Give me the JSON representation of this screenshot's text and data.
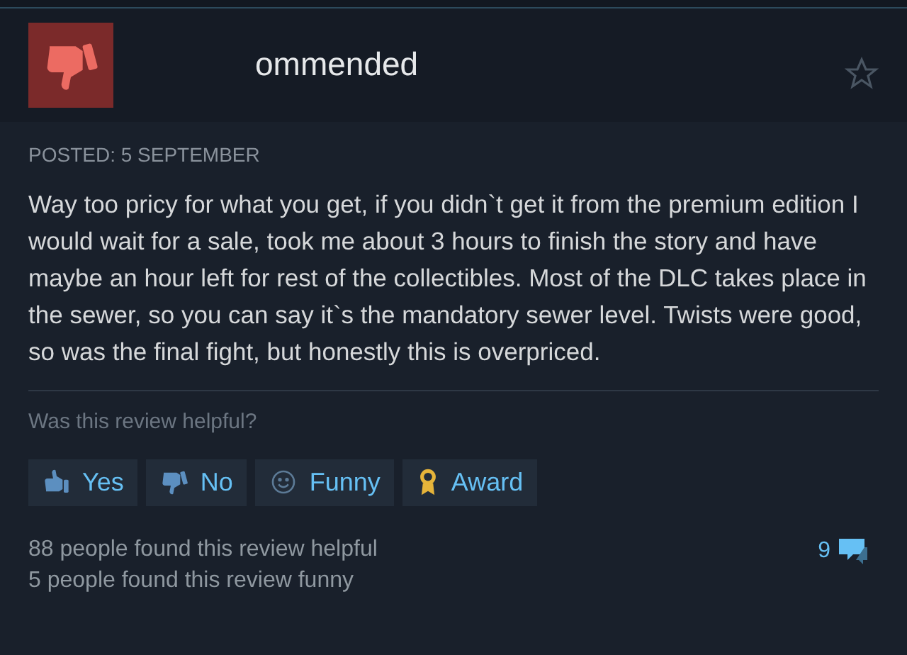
{
  "review": {
    "verdict": "ommended",
    "posted": "POSTED: 5 SEPTEMBER",
    "body": "Way too pricy for what you get, if you didn`t get it from the premium edition I would wait for a sale, took me about 3 hours to finish the story and have maybe an hour left for rest of the collectibles. Most of the DLC takes place in the sewer, so you can say it`s the mandatory sewer level. Twists were good, so was the final fight, but honestly this is overpriced."
  },
  "feedback": {
    "question": "Was this review helpful?",
    "buttons": [
      {
        "kind": "yes",
        "label": "Yes"
      },
      {
        "kind": "no",
        "label": "No"
      },
      {
        "kind": "funny",
        "label": "Funny"
      },
      {
        "kind": "award",
        "label": "Award"
      }
    ],
    "helpful": "88 people found this review helpful",
    "funny": "5 people found this review funny",
    "comments": "9"
  }
}
